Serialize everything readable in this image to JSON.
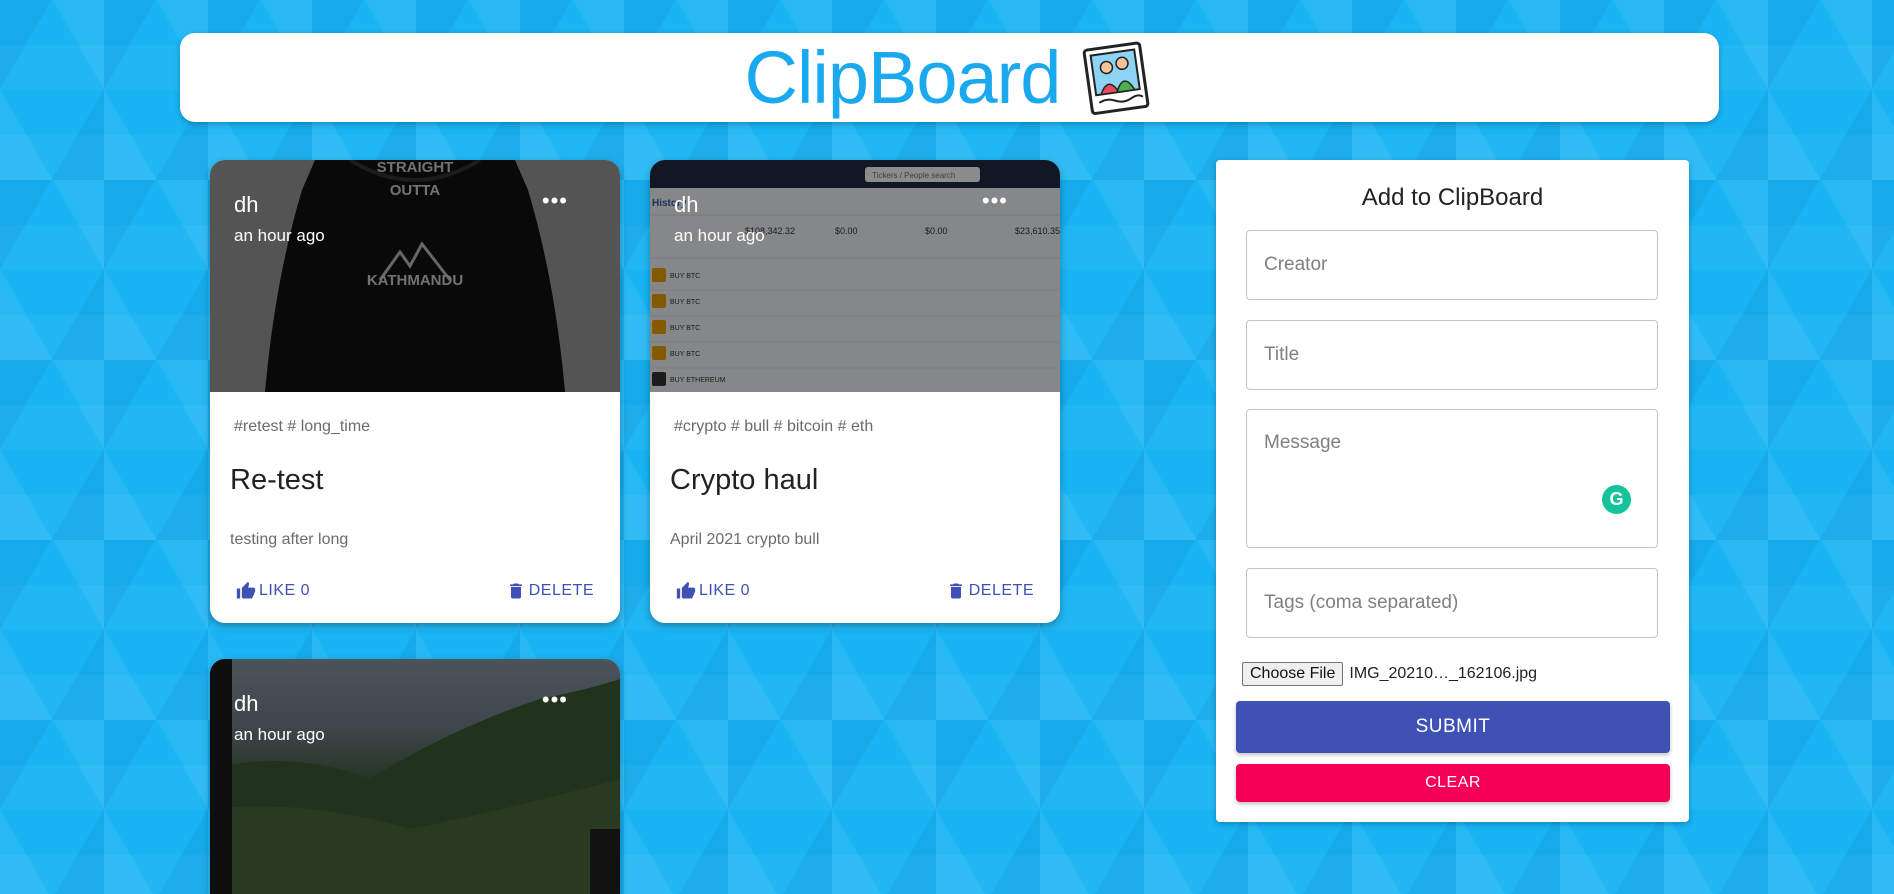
{
  "header": {
    "title": "ClipBoard",
    "logo_icon": "photo-frame-icon"
  },
  "posts": [
    {
      "creator": "dh",
      "time": "an hour ago",
      "tags": "#retest # long_time",
      "title": "Re-test",
      "message": "testing after long",
      "like_label": "LIKE 0",
      "delete_label": "DELETE",
      "image_text": [
        "STRAIGHT",
        "OUTTA",
        "KATHMANDU"
      ]
    },
    {
      "creator": "dh",
      "time": "an hour ago",
      "tags": "#crypto # bull # bitcoin # eth",
      "title": "Crypto haul",
      "message": "April 2021 crypto bull",
      "like_label": "LIKE 0",
      "delete_label": "DELETE",
      "image_text": {
        "search": "Tickers / People search",
        "tab": "History",
        "stats": [
          "$108,342.32",
          "$0.00",
          "$0.00",
          "$23,610.35"
        ],
        "rows": [
          "BUY BTC",
          "BUY BTC",
          "BUY BTC",
          "BUY BTC",
          "BUY ETHEREUM"
        ]
      }
    },
    {
      "creator": "dh",
      "time": "an hour ago"
    }
  ],
  "form": {
    "heading": "Add to ClipBoard",
    "creator_placeholder": "Creator",
    "title_placeholder": "Title",
    "message_placeholder": "Message",
    "tags_placeholder": "Tags (coma separated)",
    "file_button": "Choose File",
    "file_name": "IMG_20210…_162106.jpg",
    "submit_label": "SUBMIT",
    "clear_label": "CLEAR",
    "grammarly_letter": "G"
  },
  "colors": {
    "accent": "#3f51b5",
    "secondary": "#f50057",
    "title": "#1aa9ee",
    "background": "#18b4f4"
  }
}
